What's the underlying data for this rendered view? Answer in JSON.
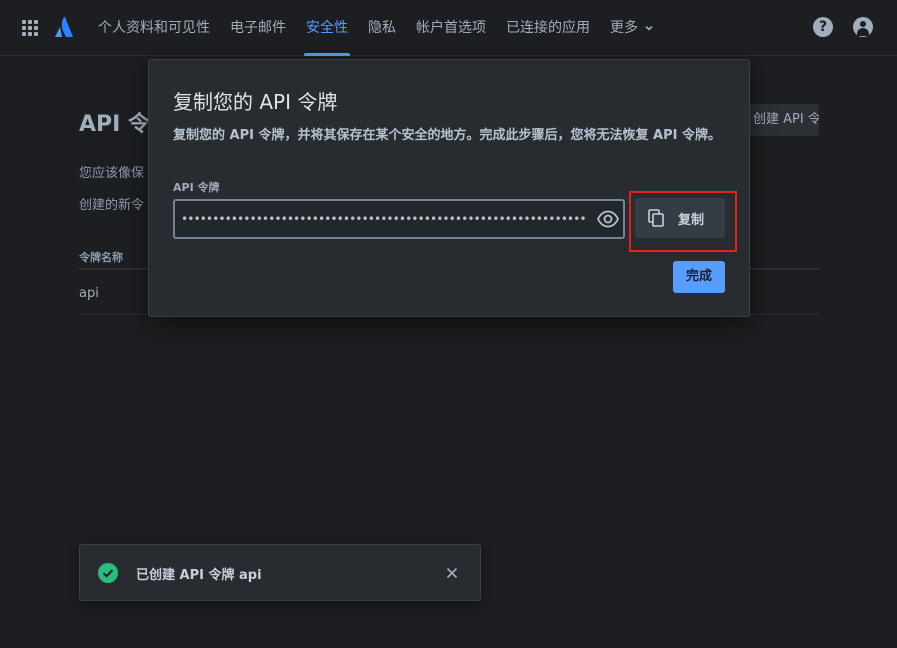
{
  "nav": {
    "items": [
      {
        "label": "个人资料和可见性"
      },
      {
        "label": "电子邮件"
      },
      {
        "label": "安全性",
        "active": true
      },
      {
        "label": "隐私"
      },
      {
        "label": "帐户首选项"
      },
      {
        "label": "已连接的应用"
      },
      {
        "label": "更多"
      }
    ],
    "help_glyph": "?"
  },
  "background": {
    "title": "API 令牌",
    "line1": "您应该像保",
    "line2": "创建的新令",
    "create_button": "创建 API 令牌",
    "column_header": "令牌名称",
    "row_name": "api"
  },
  "modal": {
    "title": "复制您的 API 令牌",
    "description": "复制您的 API 令牌，并将其保存在某个安全的地方。完成此步骤后，您将无法恢复 API 令牌。",
    "field_label": "API 令牌",
    "token_value": "••••••••••••••••••••••••••••••••••••••••••••••••••••••••••••••••••",
    "copy_label": "复制",
    "done_label": "完成"
  },
  "toast": {
    "message": "已创建 API 令牌 api"
  },
  "colors": {
    "accent": "#579dff",
    "success": "#2abb7f",
    "highlight": "#e2231a"
  }
}
